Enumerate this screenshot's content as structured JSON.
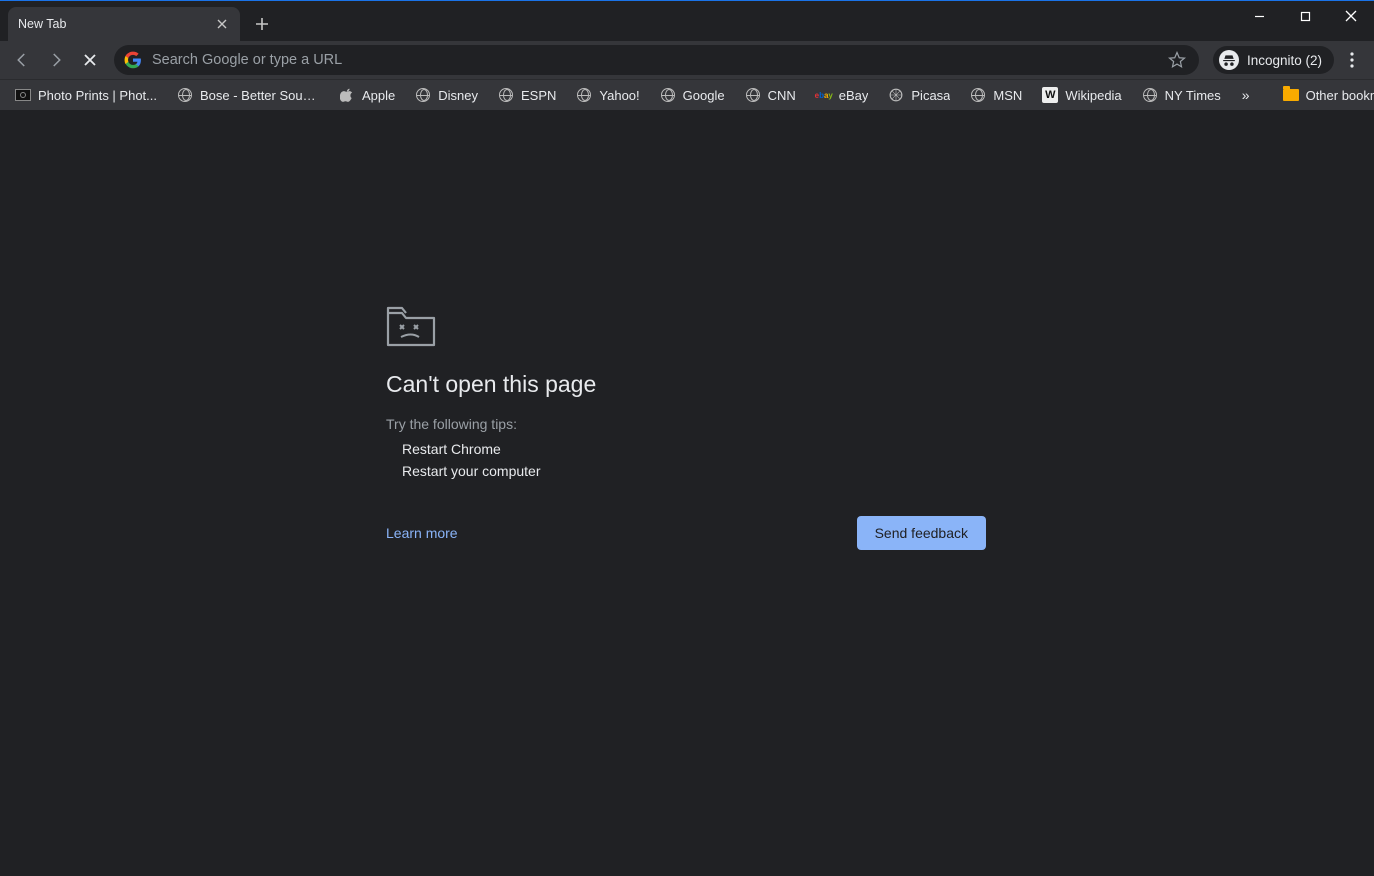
{
  "tab": {
    "title": "New Tab"
  },
  "omnibox": {
    "placeholder": "Search Google or type a URL"
  },
  "profile": {
    "label": "Incognito (2)"
  },
  "bookmarks": {
    "items": [
      {
        "label": "Photo Prints | Phot...",
        "icon": "photo"
      },
      {
        "label": "Bose - Better Soun...",
        "icon": "globe"
      },
      {
        "label": "Apple",
        "icon": "apple"
      },
      {
        "label": "Disney",
        "icon": "globe"
      },
      {
        "label": "ESPN",
        "icon": "globe"
      },
      {
        "label": "Yahoo!",
        "icon": "globe"
      },
      {
        "label": "Google",
        "icon": "globe"
      },
      {
        "label": "CNN",
        "icon": "globe"
      },
      {
        "label": "eBay",
        "icon": "ebay"
      },
      {
        "label": "Picasa",
        "icon": "picasa"
      },
      {
        "label": "MSN",
        "icon": "globe"
      },
      {
        "label": "Wikipedia",
        "icon": "wiki"
      },
      {
        "label": "NY Times",
        "icon": "globe"
      }
    ],
    "overflow_glyph": "»",
    "other_label": "Other bookmarks"
  },
  "error": {
    "title": "Can't open this page",
    "subtitle": "Try the following tips:",
    "tips": [
      "Restart Chrome",
      "Restart your computer"
    ],
    "learn_more": "Learn more",
    "feedback": "Send feedback"
  }
}
